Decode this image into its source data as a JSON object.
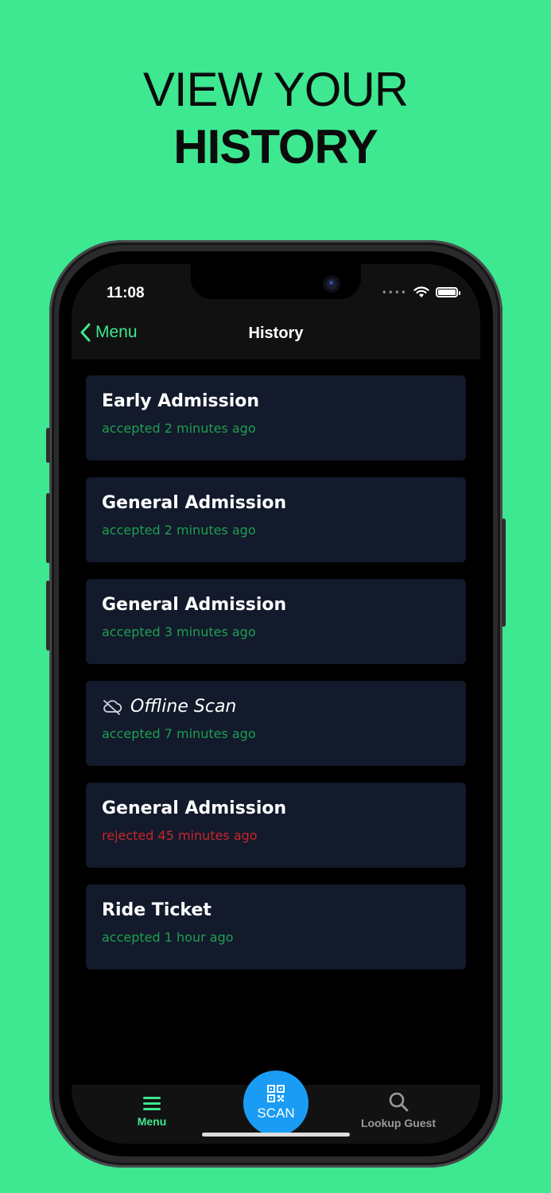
{
  "promo": {
    "line1": "VIEW YOUR",
    "line2": "HISTORY"
  },
  "status_bar": {
    "time": "11:08"
  },
  "nav": {
    "back_label": "Menu",
    "title": "History"
  },
  "history": [
    {
      "title": "Early Admission",
      "status": "accepted 2 minutes ago",
      "state": "accepted",
      "offline": false
    },
    {
      "title": "General Admission",
      "status": "accepted 2 minutes ago",
      "state": "accepted",
      "offline": false
    },
    {
      "title": "General Admission",
      "status": "accepted 3 minutes ago",
      "state": "accepted",
      "offline": false
    },
    {
      "title": "Offline Scan",
      "status": "accepted 7 minutes ago",
      "state": "accepted",
      "offline": true
    },
    {
      "title": "General Admission",
      "status": "rejected 45 minutes ago",
      "state": "rejected",
      "offline": false
    },
    {
      "title": "Ride Ticket",
      "status": "accepted 1 hour ago",
      "state": "accepted",
      "offline": false
    }
  ],
  "tabbar": {
    "menu_label": "Menu",
    "scan_label": "SCAN",
    "lookup_label": "Lookup Guest"
  },
  "colors": {
    "accent": "#3de890",
    "scan": "#1a9cf5",
    "accepted": "#1f9e52",
    "rejected": "#c8242c",
    "card": "#121a2b"
  }
}
